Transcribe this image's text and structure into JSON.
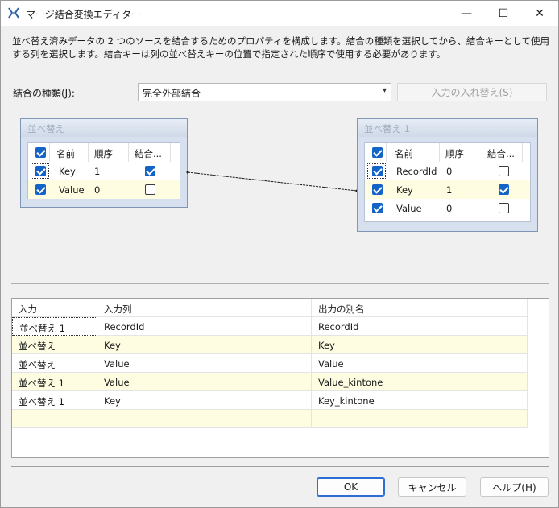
{
  "window": {
    "title": "マージ結合変換エディター",
    "min_glyph": "—",
    "max_glyph": "☐",
    "close_glyph": "✕"
  },
  "description": "並べ替え済みデータの 2 つのソースを結合するためのプロパティを構成します。結合の種類を選択してから、結合キーとして使用する列を選択します。結合キーは列の並べ替えキーの位置で指定された順序で使用する必要があります。",
  "join": {
    "label": "結合の種類(J):",
    "selected": "完全外部結合",
    "swap_label": "入力の入れ替え(S)"
  },
  "left_table": {
    "title": "並べ替え",
    "headers": [
      "名前",
      "順序",
      "結合..."
    ],
    "rows": [
      {
        "name": "Key",
        "order": "1",
        "checked": true,
        "join": true
      },
      {
        "name": "Value",
        "order": "0",
        "checked": true,
        "join": false
      }
    ]
  },
  "right_table": {
    "title": "並べ替え 1",
    "headers": [
      "名前",
      "順序",
      "結合..."
    ],
    "rows": [
      {
        "name": "RecordId",
        "order": "0",
        "checked": true,
        "join": false
      },
      {
        "name": "Key",
        "order": "1",
        "checked": true,
        "join": true
      },
      {
        "name": "Value",
        "order": "0",
        "checked": true,
        "join": false
      }
    ]
  },
  "grid": {
    "headers": [
      "入力",
      "入力列",
      "出力の別名"
    ],
    "rows": [
      [
        "並べ替え 1",
        "RecordId",
        "RecordId"
      ],
      [
        "並べ替え",
        "Key",
        "Key"
      ],
      [
        "並べ替え",
        "Value",
        "Value"
      ],
      [
        "並べ替え 1",
        "Value",
        "Value_kintone"
      ],
      [
        "並べ替え 1",
        "Key",
        "Key_kintone"
      ],
      [
        "",
        "",
        ""
      ]
    ]
  },
  "buttons": {
    "ok": "OK",
    "cancel": "キャンセル",
    "help": "ヘルプ(H)"
  },
  "colors": {
    "accent": "#1463c7",
    "row_highlight": "#fefde2",
    "node_border": "#7f96b6"
  }
}
